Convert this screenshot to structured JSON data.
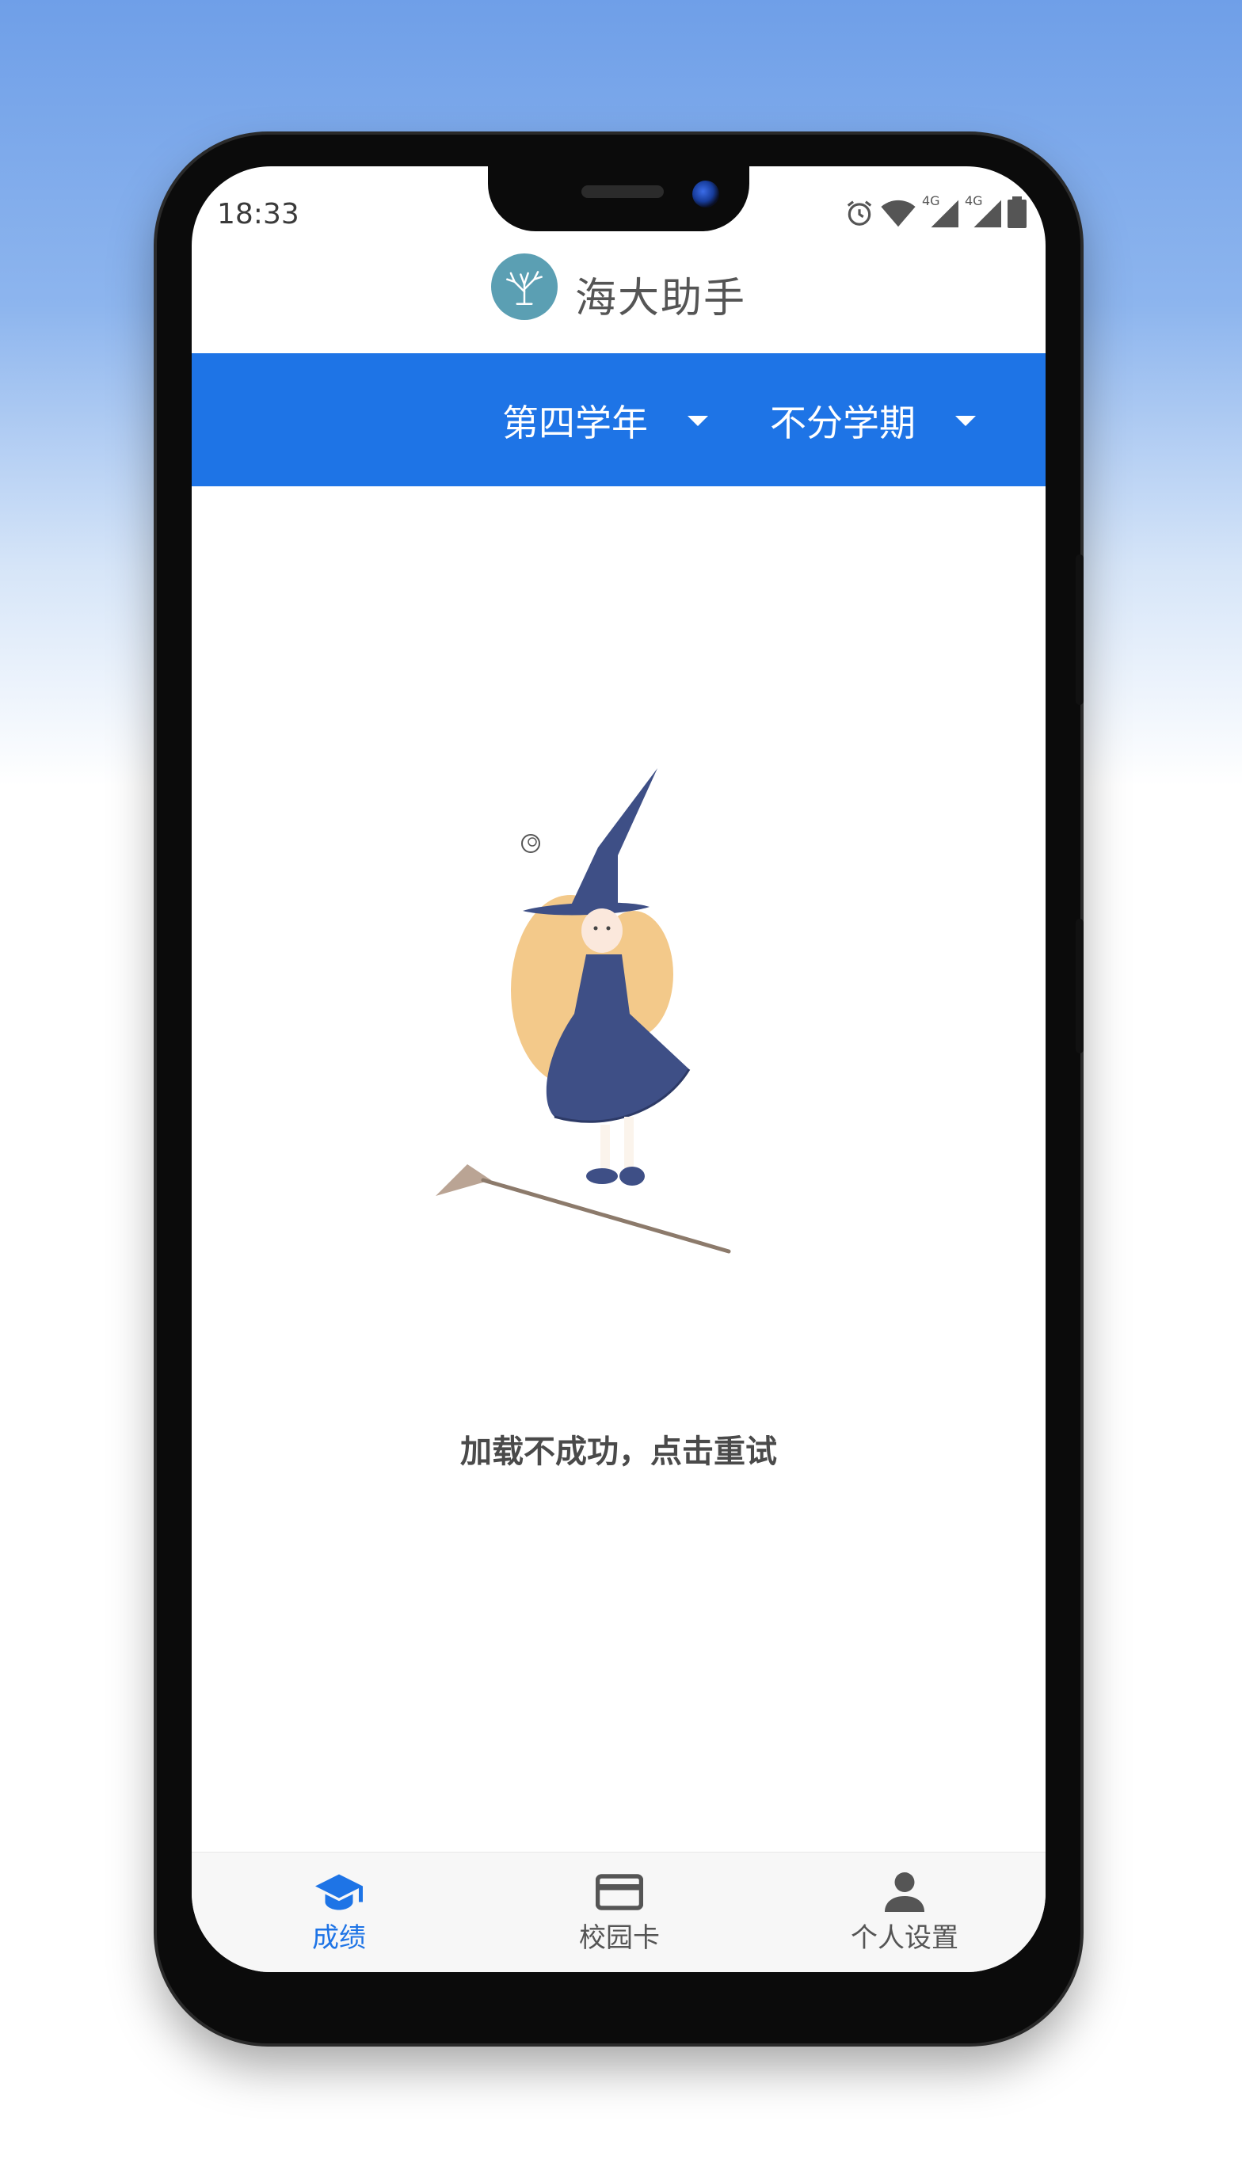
{
  "status_bar": {
    "time": "18:33",
    "network_label_1": "4G",
    "network_label_2": "4G"
  },
  "app": {
    "title": "海大助手",
    "logo_icon": "coral-tree-logo"
  },
  "filters": {
    "year": {
      "value": "第四学年",
      "icon": "caret-down-icon"
    },
    "term": {
      "value": "不分学期",
      "icon": "caret-down-icon"
    }
  },
  "error": {
    "illustration": "witch-with-broom",
    "message": "加载不成功，点击重试"
  },
  "bottom_nav": {
    "items": [
      {
        "label": "成绩",
        "icon": "graduation-cap-icon",
        "active": true
      },
      {
        "label": "校园卡",
        "icon": "card-icon",
        "active": false
      },
      {
        "label": "个人设置",
        "icon": "person-icon",
        "active": false
      }
    ]
  },
  "colors": {
    "primary": "#1e74e6",
    "active_nav": "#1e74e6",
    "inactive_nav": "#555555",
    "logo_bg": "#5b9fb3"
  }
}
